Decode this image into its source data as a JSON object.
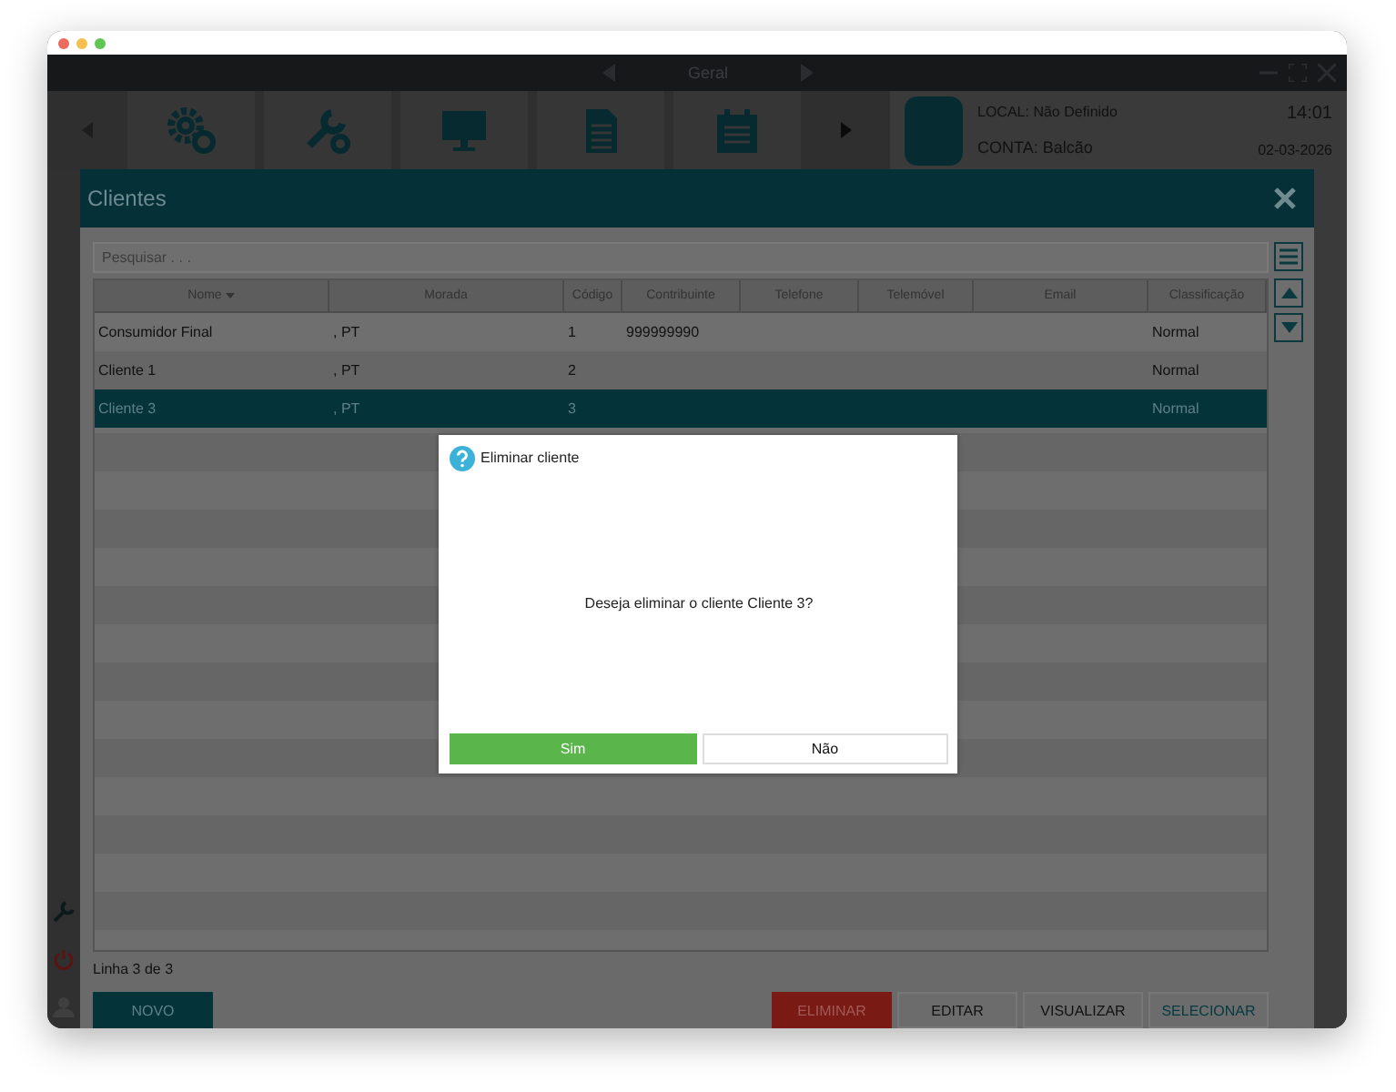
{
  "nav_bar": {
    "title": "Geral"
  },
  "info_panel": {
    "local_label": "LOCAL:",
    "local_value": "Não Definido",
    "conta_label": "CONTA:",
    "conta_value": "Balcão",
    "time": "14:01",
    "date": "02-03-2026"
  },
  "clients_dialog": {
    "title": "Clientes",
    "search": {
      "placeholder": "Pesquisar . . ."
    },
    "table": {
      "columns": [
        "Nome",
        "Morada",
        "Código",
        "Contribuinte",
        "Telefone",
        "Telemóvel",
        "Email",
        "Classificação"
      ],
      "rows": [
        {
          "nome": "Consumidor Final",
          "morada": ", PT",
          "codigo": "1",
          "contribuinte": "999999990",
          "classificacao": "Normal",
          "selected": false
        },
        {
          "nome": "Cliente 1",
          "morada": ", PT",
          "codigo": "2",
          "classificacao": "Normal",
          "selected": false
        },
        {
          "nome": "Cliente 3",
          "morada": ", PT",
          "codigo": "3",
          "classificacao": "Normal",
          "selected": true
        }
      ]
    },
    "status": "Linha 3 de 3",
    "buttons": [
      {
        "label": "NOVO",
        "kind": "primary"
      },
      {
        "label": "ELIMINAR",
        "kind": "danger"
      },
      {
        "label": "EDITAR",
        "kind": "plain"
      },
      {
        "label": "VISUALIZAR",
        "kind": "plain"
      },
      {
        "label": "SELECIONAR",
        "kind": "accent"
      }
    ]
  },
  "confirm_modal": {
    "title": "Eliminar cliente",
    "message": "Deseja eliminar o cliente Cliente 3?",
    "buttons": [
      {
        "label": "Sim",
        "kind": "confirm"
      },
      {
        "label": "Não",
        "kind": "cancel"
      }
    ]
  }
}
